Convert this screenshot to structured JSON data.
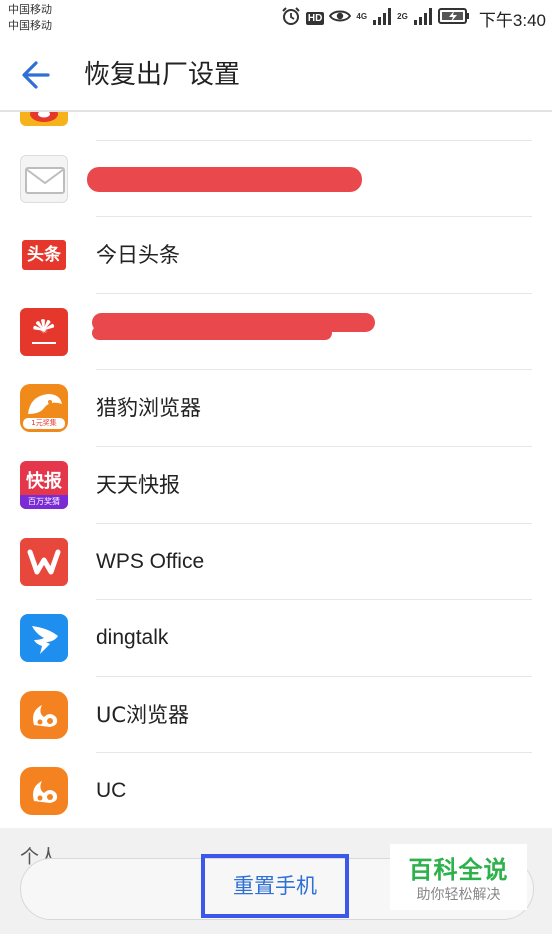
{
  "status_bar": {
    "carrier_1": "中国移动",
    "carrier_2": "中国移动",
    "hd": "HD",
    "net_1": "4G",
    "net_2": "2G",
    "time": "下午3:40"
  },
  "header": {
    "title": "恢复出厂设置"
  },
  "apps": [
    {
      "label": "",
      "icon": "weibo-icon",
      "redacted": false
    },
    {
      "label": "",
      "icon": "mail-icon",
      "redacted": true
    },
    {
      "label": "今日头条",
      "icon": "toutiao-icon",
      "icon_text": "头条"
    },
    {
      "label": "",
      "icon": "huawei-icon",
      "redacted": true
    },
    {
      "label": "猎豹浏览器",
      "icon": "cheetah-browser-icon",
      "icon_text": "1元奖集"
    },
    {
      "label": "天天快报",
      "icon": "kuaibao-icon",
      "icon_text": "快报",
      "icon_sub": "百万奖猜"
    },
    {
      "label": "WPS Office",
      "icon": "wps-icon"
    },
    {
      "label": "dingtalk",
      "icon": "dingtalk-icon"
    },
    {
      "label": "UC浏览器",
      "icon": "uc-browser-icon"
    },
    {
      "label": "UC",
      "icon": "uc-icon"
    }
  ],
  "section": {
    "label": "个人"
  },
  "actions": {
    "reset_label": "重置手机"
  },
  "watermark": {
    "title": "百科全说",
    "subtitle": "助你轻松解决"
  },
  "colors": {
    "accent_blue": "#2f6fd6",
    "highlight_blue": "#3d58e8",
    "redaction_red": "#e9494d",
    "watermark_green": "#2db14a"
  }
}
